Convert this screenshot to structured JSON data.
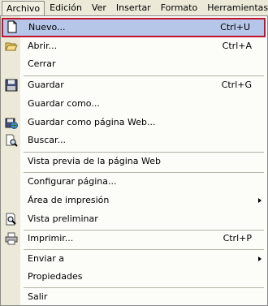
{
  "menubar": {
    "items": [
      "Archivo",
      "Edición",
      "Ver",
      "Insertar",
      "Formato",
      "Herramientas"
    ]
  },
  "menu": {
    "items": [
      {
        "label": "Nuevo...",
        "shortcut": "Ctrl+U",
        "icon": "new-document-icon"
      },
      {
        "label": "Abrir...",
        "shortcut": "Ctrl+A",
        "icon": "open-folder-icon"
      },
      {
        "label": "Cerrar",
        "shortcut": ""
      },
      {
        "label": "Guardar",
        "shortcut": "Ctrl+G",
        "icon": "save-disk-icon"
      },
      {
        "label": "Guardar como...",
        "shortcut": ""
      },
      {
        "label": "Guardar como página Web...",
        "shortcut": "",
        "icon": "save-web-icon"
      },
      {
        "label": "Buscar...",
        "shortcut": "",
        "icon": "search-file-icon"
      },
      {
        "label": "Vista previa de la página Web",
        "shortcut": ""
      },
      {
        "label": "Configurar página...",
        "shortcut": ""
      },
      {
        "label": "Área de impresión",
        "shortcut": "",
        "submenu": true
      },
      {
        "label": "Vista preliminar",
        "shortcut": "",
        "icon": "print-preview-icon"
      },
      {
        "label": "Imprimir...",
        "shortcut": "Ctrl+P",
        "icon": "printer-icon"
      },
      {
        "label": "Enviar a",
        "shortcut": "",
        "submenu": true
      },
      {
        "label": "Propiedades",
        "shortcut": ""
      },
      {
        "label": "Salir",
        "shortcut": ""
      }
    ]
  },
  "colors": {
    "highlight_bg": "#b6c6e8",
    "highlight_border": "#c0142e",
    "gutter": "#ece9d8"
  }
}
